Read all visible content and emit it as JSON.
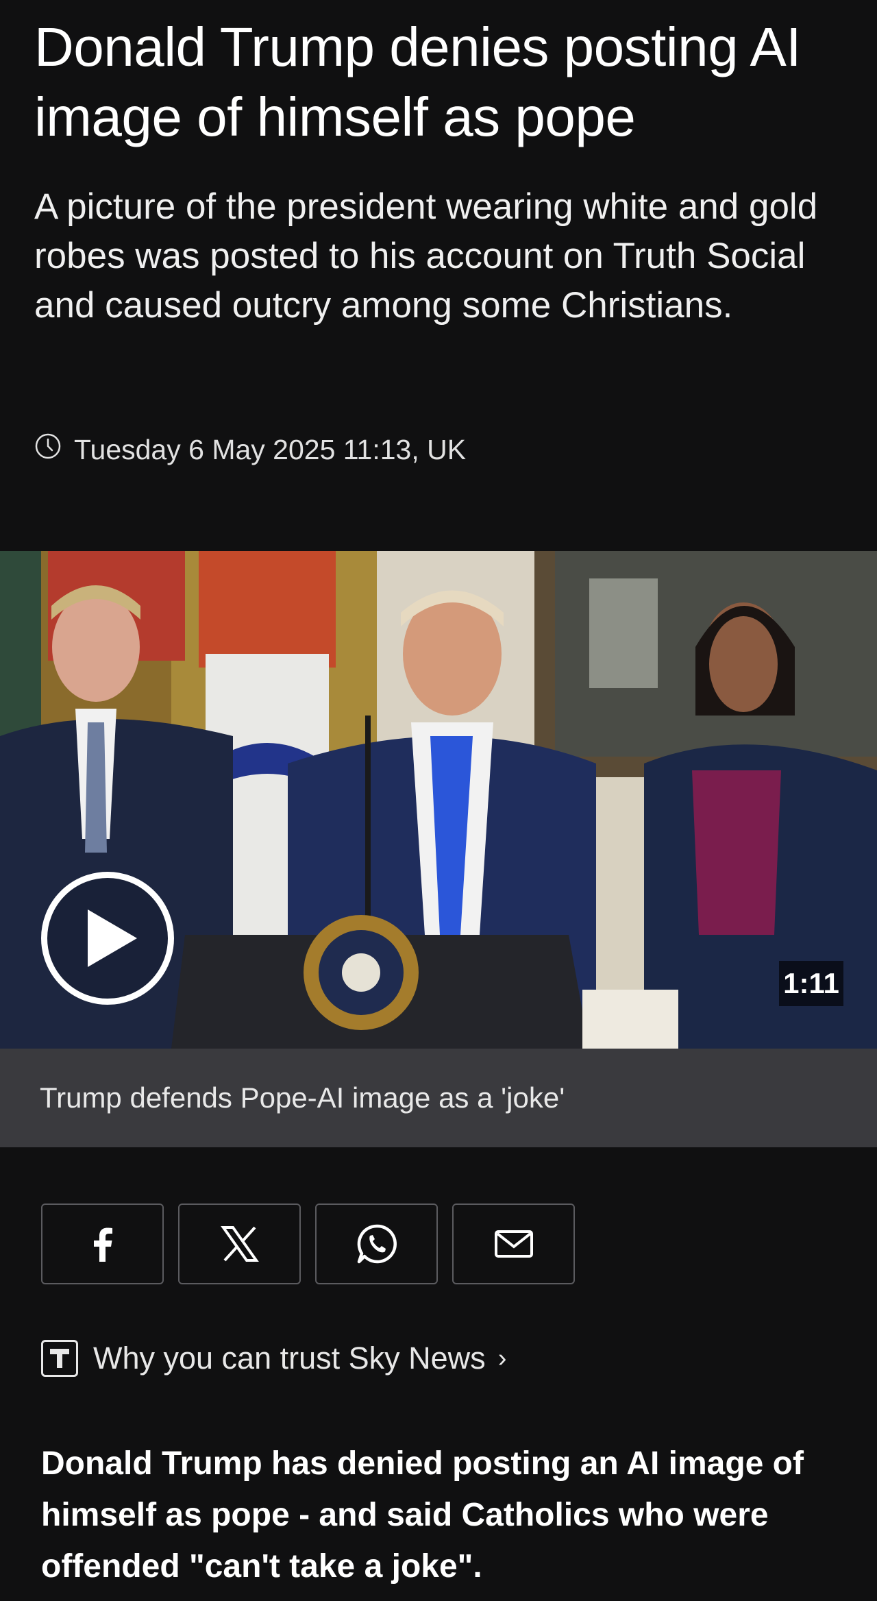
{
  "article": {
    "headline": "Donald Trump denies posting AI image of himself as pope",
    "standfirst": "A picture of the president wearing white and gold robes was posted to his account on Truth Social and caused outcry among some Christians.",
    "timestamp": "Tuesday 6 May 2025 11:13, UK",
    "timestamp_icon": "clock-icon"
  },
  "video": {
    "duration": "1:11",
    "caption": "Trump defends Pope-AI image as a 'joke'",
    "play_icon": "play-icon"
  },
  "share": {
    "buttons": [
      {
        "icon": "facebook-icon"
      },
      {
        "icon": "x-icon"
      },
      {
        "icon": "whatsapp-icon"
      },
      {
        "icon": "email-icon"
      }
    ]
  },
  "trust": {
    "label": "Why you can trust Sky News",
    "chevron": "›",
    "icon": "trust-t-icon"
  },
  "body": {
    "lead": "Donald Trump has denied posting an AI image of himself as pope - and said Catholics who were offended \"can't take a joke\"."
  },
  "colors": {
    "background": "#101011",
    "caption_bar": "#3a3a3e",
    "text": "#ffffff"
  }
}
